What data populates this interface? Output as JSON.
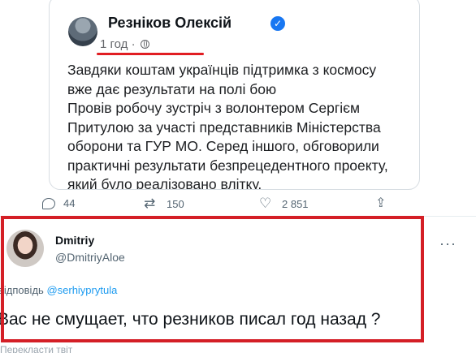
{
  "embedded_post": {
    "author": "Резніков Олексій",
    "time": "1 год ·",
    "lines": [
      "Завдяки коштам українців підтримка з космосу",
      "вже дає результати на полі бою",
      "Провів робочу зустріч з волонтером Сергієм",
      "Притулою за участі представників Міністерства",
      "оборони та ГУР МО. Серед іншого, обговорили",
      "практичні результати безпрецедентного проекту,",
      "який було реалізовано влітку."
    ]
  },
  "tweet_actions": {
    "replies": "44",
    "retweets": "150",
    "likes": "2 851"
  },
  "reply": {
    "name": "Dmitriy",
    "handle": "@DmitriyAloe",
    "replying_prefix": "відповідь",
    "replying_mention": "@serhiyprytula",
    "text": "Вас не смущает, что резников писал год назад ?",
    "cut_off_text": "Перекласти твіт"
  },
  "colors": {
    "highlight_red": "#d41f26",
    "link_blue": "#1d9bf0",
    "verified_blue": "#1877f2"
  },
  "icons": [
    "verified-icon",
    "globe-icon",
    "reply-icon",
    "retweet-icon",
    "like-icon",
    "share-icon",
    "more-icon"
  ]
}
